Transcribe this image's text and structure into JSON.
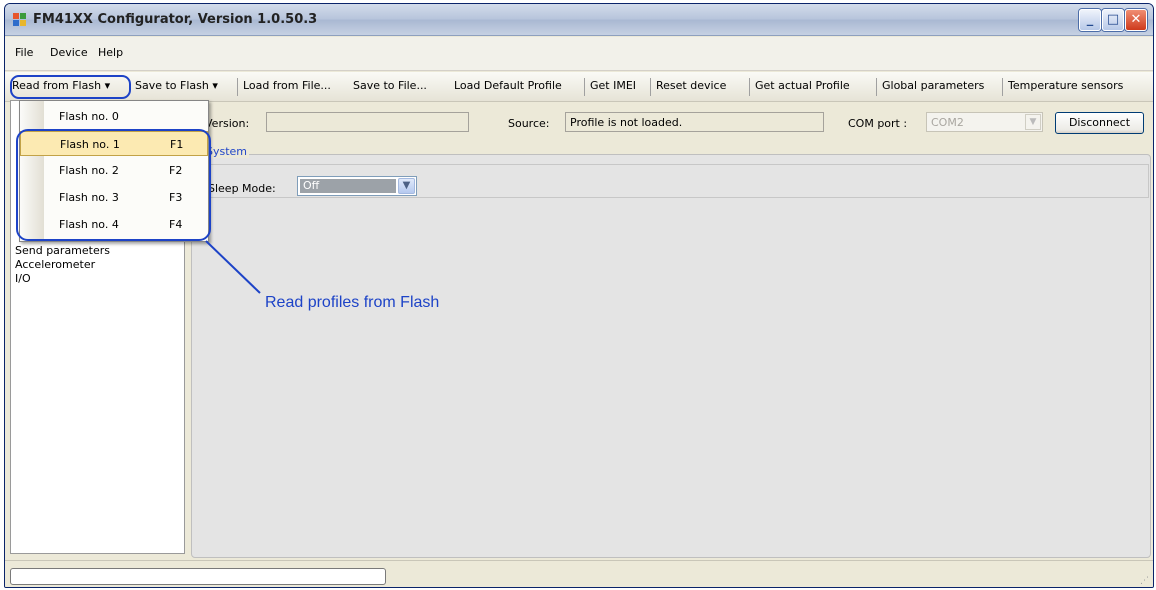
{
  "window": {
    "title": "FM41XX Configurator, Version 1.0.50.3",
    "controls": {
      "minimize": "_",
      "maximize": "□",
      "close": "✕"
    }
  },
  "menu": [
    "File",
    "Device",
    "Help"
  ],
  "toolbar": {
    "read_from_flash": "Read from Flash",
    "save_to_flash": "Save to Flash",
    "load_from_file": "Load from File...",
    "save_to_file": "Save to File...",
    "load_default_profile": "Load Default Profile",
    "get_imei": "Get IMEI",
    "reset_device": "Reset device",
    "get_actual_profile": "Get actual Profile",
    "global_parameters": "Global parameters",
    "temperature_sensors": "Temperature sensors",
    "dropdown_arrow": "▾"
  },
  "flash_menu": [
    {
      "label": "Flash no. 0",
      "shortcut": ""
    },
    {
      "label": "Flash no. 1",
      "shortcut": "F1"
    },
    {
      "label": "Flash no. 2",
      "shortcut": "F2"
    },
    {
      "label": "Flash no. 3",
      "shortcut": "F3"
    },
    {
      "label": "Flash no. 4",
      "shortcut": "F4"
    }
  ],
  "sidebar": {
    "items": [
      "Send parameters",
      "Accelerometer",
      "I/O"
    ]
  },
  "info": {
    "version_label": "Version:",
    "version_value": "",
    "source_label": "Source:",
    "source_value": "Profile is not loaded.",
    "com_label": "COM port :",
    "com_value": "COM2",
    "disconnect": "Disconnect"
  },
  "system": {
    "group_title": "System",
    "sleep_label": "Sleep Mode:",
    "sleep_value": "Off"
  },
  "annotation": {
    "text": "Read profiles from Flash"
  },
  "colors": {
    "annotation": "#1D43C7",
    "selected_item": "#FCEAB2"
  }
}
